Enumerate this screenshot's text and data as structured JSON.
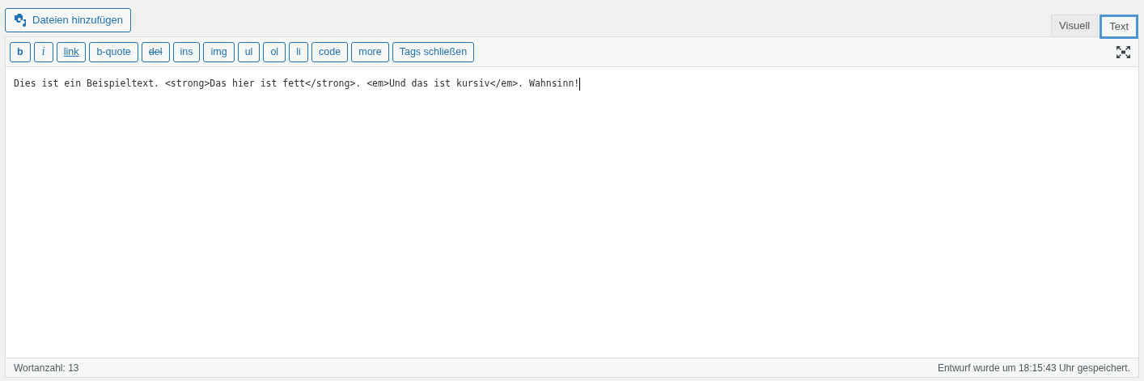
{
  "add_media_button": {
    "label": "Dateien hinzufügen"
  },
  "tabs": [
    {
      "label": "Visuell",
      "selected": false
    },
    {
      "label": "Text",
      "selected": true
    }
  ],
  "quicktags": [
    {
      "label": "b",
      "kind": "bold"
    },
    {
      "label": "i",
      "kind": "italic"
    },
    {
      "label": "link",
      "kind": "link"
    },
    {
      "label": "b-quote",
      "kind": "plain"
    },
    {
      "label": "del",
      "kind": "del"
    },
    {
      "label": "ins",
      "kind": "plain"
    },
    {
      "label": "img",
      "kind": "plain"
    },
    {
      "label": "ul",
      "kind": "plain"
    },
    {
      "label": "ol",
      "kind": "plain"
    },
    {
      "label": "li",
      "kind": "plain"
    },
    {
      "label": "code",
      "kind": "plain"
    },
    {
      "label": "more",
      "kind": "plain"
    },
    {
      "label": "Tags schließen",
      "kind": "plain"
    }
  ],
  "editor": {
    "content": "Dies ist ein Beispieltext. <strong>Das hier ist fett</strong>. <em>Und das ist kursiv</em>. Wahnsinn!"
  },
  "status_bar": {
    "word_count": "Wortanzahl: 13",
    "saved": "Entwurf wurde um 18:15:43 Uhr gespeichert."
  }
}
